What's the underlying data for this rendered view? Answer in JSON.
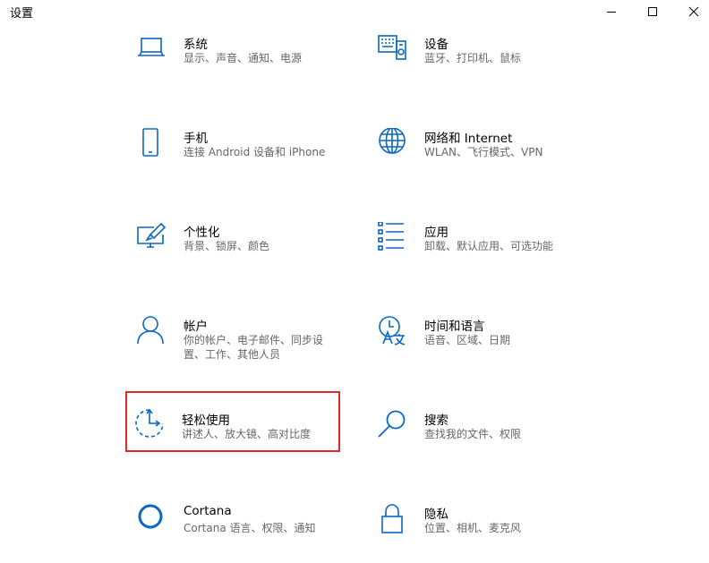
{
  "window": {
    "title": "设置"
  },
  "accent": "#0a67c2",
  "highlight_color": "#e02a2a",
  "tiles": [
    {
      "name": "系统",
      "desc": "显示、声音、通知、电源",
      "icon": "laptop-icon"
    },
    {
      "name": "设备",
      "desc": "蓝牙、打印机、鼠标",
      "icon": "keyboard-devices-icon"
    },
    {
      "name": "手机",
      "desc": "连接 Android 设备和 iPhone",
      "icon": "phone-icon"
    },
    {
      "name": "网络和 Internet",
      "desc": "WLAN、飞行模式、VPN",
      "icon": "globe-icon"
    },
    {
      "name": "个性化",
      "desc": "背景、锁屏、颜色",
      "icon": "paint-monitor-icon"
    },
    {
      "name": "应用",
      "desc": "卸载、默认应用、可选功能",
      "icon": "apps-list-icon"
    },
    {
      "name": "帐户",
      "desc": "你的帐户、电子邮件、同步设置、工作、其他人员",
      "icon": "person-icon"
    },
    {
      "name": "时间和语言",
      "desc": "语音、区域、日期",
      "icon": "time-language-icon"
    },
    {
      "name": "轻松使用",
      "desc": "讲述人、放大镜、高对比度",
      "icon": "ease-of-access-icon",
      "highlighted": true
    },
    {
      "name": "搜索",
      "desc": "查找我的文件、权限",
      "icon": "search-icon"
    },
    {
      "name": "Cortana",
      "desc": "Cortana 语言、权限、通知",
      "icon": "cortana-icon"
    },
    {
      "name": "隐私",
      "desc": "位置、相机、麦克风",
      "icon": "lock-icon"
    }
  ]
}
